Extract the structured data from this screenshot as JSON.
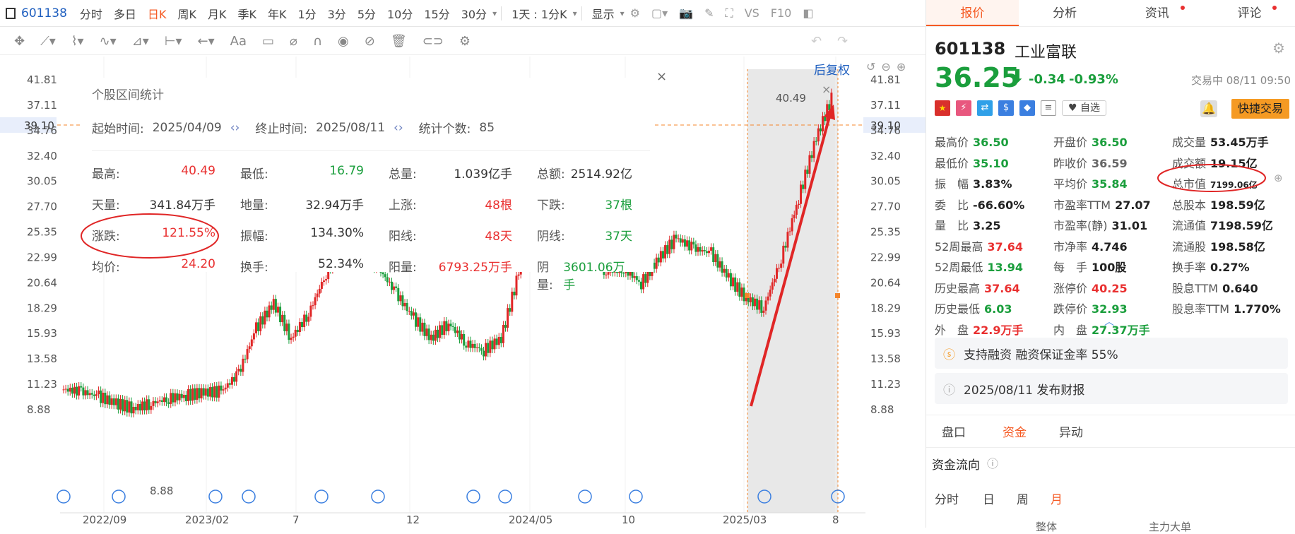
{
  "topbar": {
    "code": "601138",
    "items": [
      "分时",
      "多日",
      "日K",
      "周K",
      "月K",
      "季K",
      "年K",
      "1分",
      "3分",
      "5分",
      "10分",
      "15分",
      "30分"
    ],
    "active": "日K",
    "range": "1天 : 1分K",
    "display": "显示",
    "vs": "VS",
    "f10": "F10"
  },
  "chart": {
    "restore": "后复权",
    "yticks": [
      "41.81",
      "37.11",
      "34.76",
      "32.40",
      "30.05",
      "27.70",
      "25.35",
      "22.99",
      "20.64",
      "18.29",
      "15.93",
      "13.58",
      "11.23",
      "8.88"
    ],
    "price_tag": "39.10",
    "xticks": [
      "2022/09",
      "2023/02",
      "7",
      "12",
      "2024/05",
      "10",
      "2025/03",
      "8"
    ],
    "high_label": "40.49",
    "low_label": "8.88",
    "candles_close": [
      10.9,
      10.7,
      10.2,
      9.5,
      9.0,
      9.5,
      10.0,
      10.3,
      10.6,
      10.7,
      12.5,
      17.0,
      19.5,
      16.0,
      18.5,
      22.5,
      26.0,
      25.0,
      23.0,
      20.5,
      18.0,
      16.0,
      17.5,
      15.5,
      14.8,
      16.0,
      22.5,
      26.0,
      25.5,
      27.0,
      26.0,
      22.5,
      23.0,
      21.5,
      24.0,
      26.0,
      25.0,
      24.5,
      22.0,
      20.0,
      19.0,
      24.0,
      30.0,
      36.0,
      40.49
    ]
  },
  "stats": {
    "title": "个股区间统计",
    "start_label": "起始时间:",
    "start": "2025/04/09",
    "end_label": "终止时间:",
    "end": "2025/08/11",
    "count_label": "统计个数:",
    "count": "85",
    "rows": [
      [
        {
          "k": "最高:",
          "v": "40.49",
          "c": "red"
        },
        {
          "k": "最低:",
          "v": "16.79",
          "c": "green"
        },
        {
          "k": "总量:",
          "v": "1.039亿手",
          "c": ""
        },
        {
          "k": "总额:",
          "v": "2514.92亿",
          "c": ""
        }
      ],
      [
        {
          "k": "天量:",
          "v": "341.84万手",
          "c": ""
        },
        {
          "k": "地量:",
          "v": "32.94万手",
          "c": ""
        },
        {
          "k": "上涨:",
          "v": "48根",
          "c": "red"
        },
        {
          "k": "下跌:",
          "v": "37根",
          "c": "green"
        }
      ],
      [
        {
          "k": "涨跌:",
          "v": "121.55%",
          "c": "red"
        },
        {
          "k": "振幅:",
          "v": "134.30%",
          "c": ""
        },
        {
          "k": "阳线:",
          "v": "48天",
          "c": "red"
        },
        {
          "k": "阴线:",
          "v": "37天",
          "c": "green"
        }
      ],
      [
        {
          "k": "均价:",
          "v": "24.20",
          "c": "red"
        },
        {
          "k": "换手:",
          "v": "52.34%",
          "c": ""
        },
        {
          "k": "阳量:",
          "v": "6793.25万手",
          "c": "red"
        },
        {
          "k": "阴量:",
          "v": "3601.06万手",
          "c": "green"
        }
      ]
    ]
  },
  "right": {
    "tabs": [
      "报价",
      "分析",
      "资讯",
      "评论"
    ],
    "code": "601138",
    "name": "工业富联",
    "price": "36.25",
    "change": "-0.34",
    "pct": "-0.93%",
    "status": "交易中 08/11 09:50",
    "watch": "自选",
    "quick": "快捷交易",
    "quotes": [
      [
        {
          "k": "最高价",
          "v": "36.50",
          "c": "green"
        },
        {
          "k": "开盘价",
          "v": "36.50",
          "c": "green"
        },
        {
          "k": "成交量",
          "v": "53.45万手",
          "c": ""
        }
      ],
      [
        {
          "k": "最低价",
          "v": "35.10",
          "c": "green"
        },
        {
          "k": "昨收价",
          "v": "36.59",
          "c": "gray"
        },
        {
          "k": "成交额",
          "v": "19.15亿",
          "c": ""
        }
      ],
      [
        {
          "k": "振　幅",
          "v": "3.83%",
          "c": ""
        },
        {
          "k": "平均价",
          "v": "35.84",
          "c": "green"
        },
        {
          "k": "总市值",
          "v": "7199.06亿",
          "c": "small"
        }
      ],
      [
        {
          "k": "委　比",
          "v": "-66.60%",
          "c": ""
        },
        {
          "k": "市盈率TTM",
          "v": "27.07",
          "c": ""
        },
        {
          "k": "总股本",
          "v": "198.59亿",
          "c": ""
        }
      ],
      [
        {
          "k": "量　比",
          "v": "3.25",
          "c": ""
        },
        {
          "k": "市盈率(静)",
          "v": "31.01",
          "c": ""
        },
        {
          "k": "流通值",
          "v": "7198.59亿",
          "c": ""
        }
      ],
      [
        {
          "k": "52周最高",
          "v": "37.64",
          "c": "red"
        },
        {
          "k": "市净率",
          "v": "4.746",
          "c": ""
        },
        {
          "k": "流通股",
          "v": "198.58亿",
          "c": ""
        }
      ],
      [
        {
          "k": "52周最低",
          "v": "13.94",
          "c": "green"
        },
        {
          "k": "每　手",
          "v": "100股",
          "c": ""
        },
        {
          "k": "换手率",
          "v": "0.27%",
          "c": ""
        }
      ],
      [
        {
          "k": "历史最高",
          "v": "37.64",
          "c": "red"
        },
        {
          "k": "涨停价",
          "v": "40.25",
          "c": "red"
        },
        {
          "k": "股息TTM",
          "v": "0.640",
          "c": ""
        }
      ],
      [
        {
          "k": "历史最低",
          "v": "6.03",
          "c": "green"
        },
        {
          "k": "跌停价",
          "v": "32.93",
          "c": "green"
        },
        {
          "k": "股息率TTM",
          "v": "1.770%",
          "c": ""
        }
      ],
      [
        {
          "k": "外　盘",
          "v": "22.9万手",
          "c": "red"
        },
        {
          "k": "内　盘",
          "v": "27.37万手",
          "c": "green"
        },
        {
          "k": "",
          "v": "",
          "c": ""
        }
      ]
    ],
    "margin": "支持融资 融资保证金率 55%",
    "report": "2025/08/11  发布财报",
    "subtabs": [
      "盘口",
      "资金",
      "异动"
    ],
    "flow_title": "资金流向",
    "periods": [
      "分时",
      "日",
      "周",
      "月"
    ],
    "bottom_cols": [
      "整体",
      "主力大单"
    ]
  }
}
